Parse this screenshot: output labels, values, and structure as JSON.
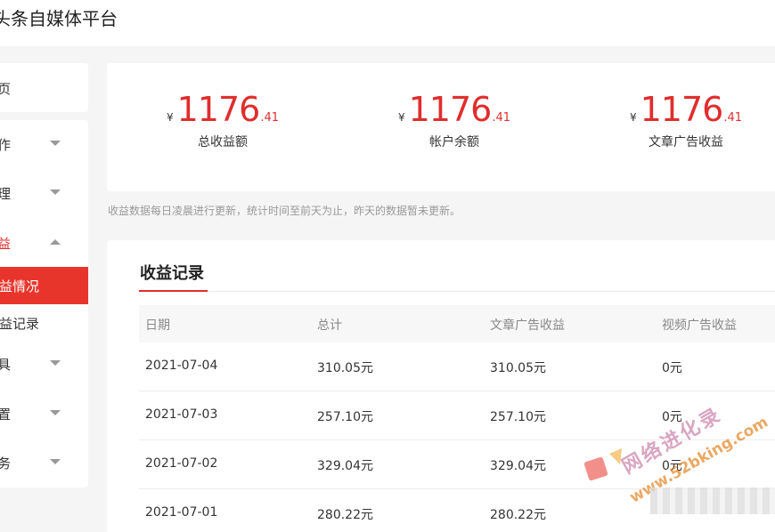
{
  "header": {
    "title": "头条自媒体平台"
  },
  "sidebar": {
    "top_item": "首页",
    "items": [
      {
        "label": "创作",
        "caret": "down"
      },
      {
        "label": "管理",
        "caret": "down"
      },
      {
        "label": "收益",
        "caret": "up",
        "open": true
      }
    ],
    "sub_items": [
      {
        "label": "收益情况",
        "active": true
      },
      {
        "label": "收益记录",
        "active": false
      }
    ],
    "more_items": [
      {
        "label": "工具",
        "caret": "down"
      },
      {
        "label": "设置",
        "caret": "down"
      },
      {
        "label": "服务",
        "caret": "down"
      }
    ]
  },
  "stats": [
    {
      "currency": "¥",
      "integer": "1176",
      "decimal": ".41",
      "caption": "总收益额"
    },
    {
      "currency": "¥",
      "integer": "1176",
      "decimal": ".41",
      "caption": "帐户余额"
    },
    {
      "currency": "¥",
      "integer": "1176",
      "decimal": ".41",
      "caption": "文章广告收益"
    }
  ],
  "notice": "收益数据每日凌晨进行更新，统计时间至前天为止，昨天的数据暂未更新。",
  "records": {
    "title": "收益记录",
    "columns": [
      "日期",
      "总计",
      "文章广告收益",
      "视频广告收益"
    ],
    "rows": [
      [
        "2021-07-04",
        "310.05元",
        "310.05元",
        "0元"
      ],
      [
        "2021-07-03",
        "257.10元",
        "257.10元",
        "0元"
      ],
      [
        "2021-07-02",
        "329.04元",
        "329.04元",
        "0元"
      ],
      [
        "2021-07-01",
        "280.22元",
        "280.22元",
        ""
      ]
    ]
  },
  "watermark": {
    "text_cn": "网络进化录",
    "text_url": "www.52bking.com"
  },
  "colors": {
    "accent": "#e02d2d",
    "active_bg": "#e8352c"
  }
}
